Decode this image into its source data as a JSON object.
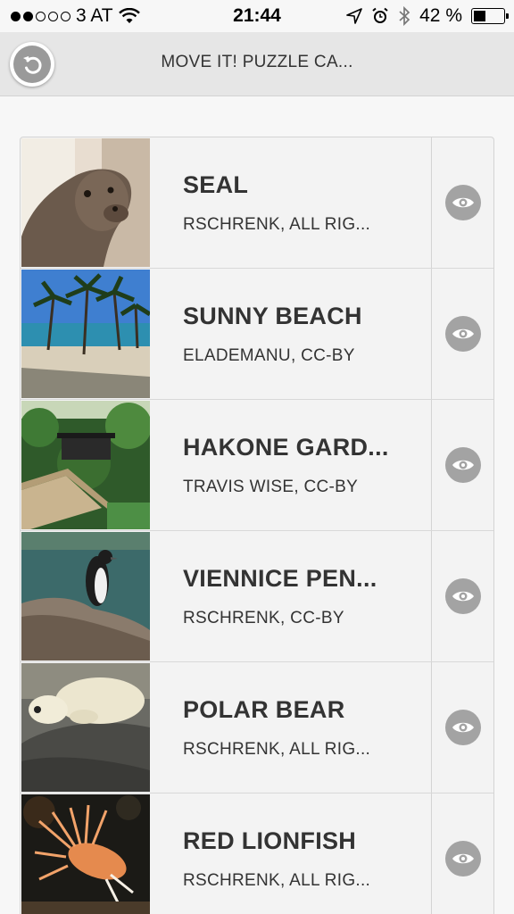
{
  "status_bar": {
    "carrier": "3 AT",
    "time": "21:44",
    "battery_percent": "42 %",
    "battery_level": 0.42,
    "signal_dots_filled": 2,
    "signal_dots_total": 5
  },
  "nav": {
    "title": "MOVE IT! PUZZLE CA...",
    "back_icon": "back-arrow-icon"
  },
  "puzzles": [
    {
      "title": "SEAL",
      "credit": "RSCHRENK, ALL RIG...",
      "image": "seal"
    },
    {
      "title": "SUNNY BEACH",
      "credit": "ELADEMANU, CC-BY",
      "image": "beach"
    },
    {
      "title": "HAKONE GARD...",
      "credit": "TRAVIS WISE, CC-BY",
      "image": "garden"
    },
    {
      "title": "VIENNICE PEN...",
      "credit": "RSCHRENK, CC-BY",
      "image": "penguin"
    },
    {
      "title": "POLAR BEAR",
      "credit": "RSCHRENK, ALL RIG...",
      "image": "polar-bear"
    },
    {
      "title": "RED LIONFISH",
      "credit": "RSCHRENK, ALL RIG...",
      "image": "lionfish"
    }
  ]
}
